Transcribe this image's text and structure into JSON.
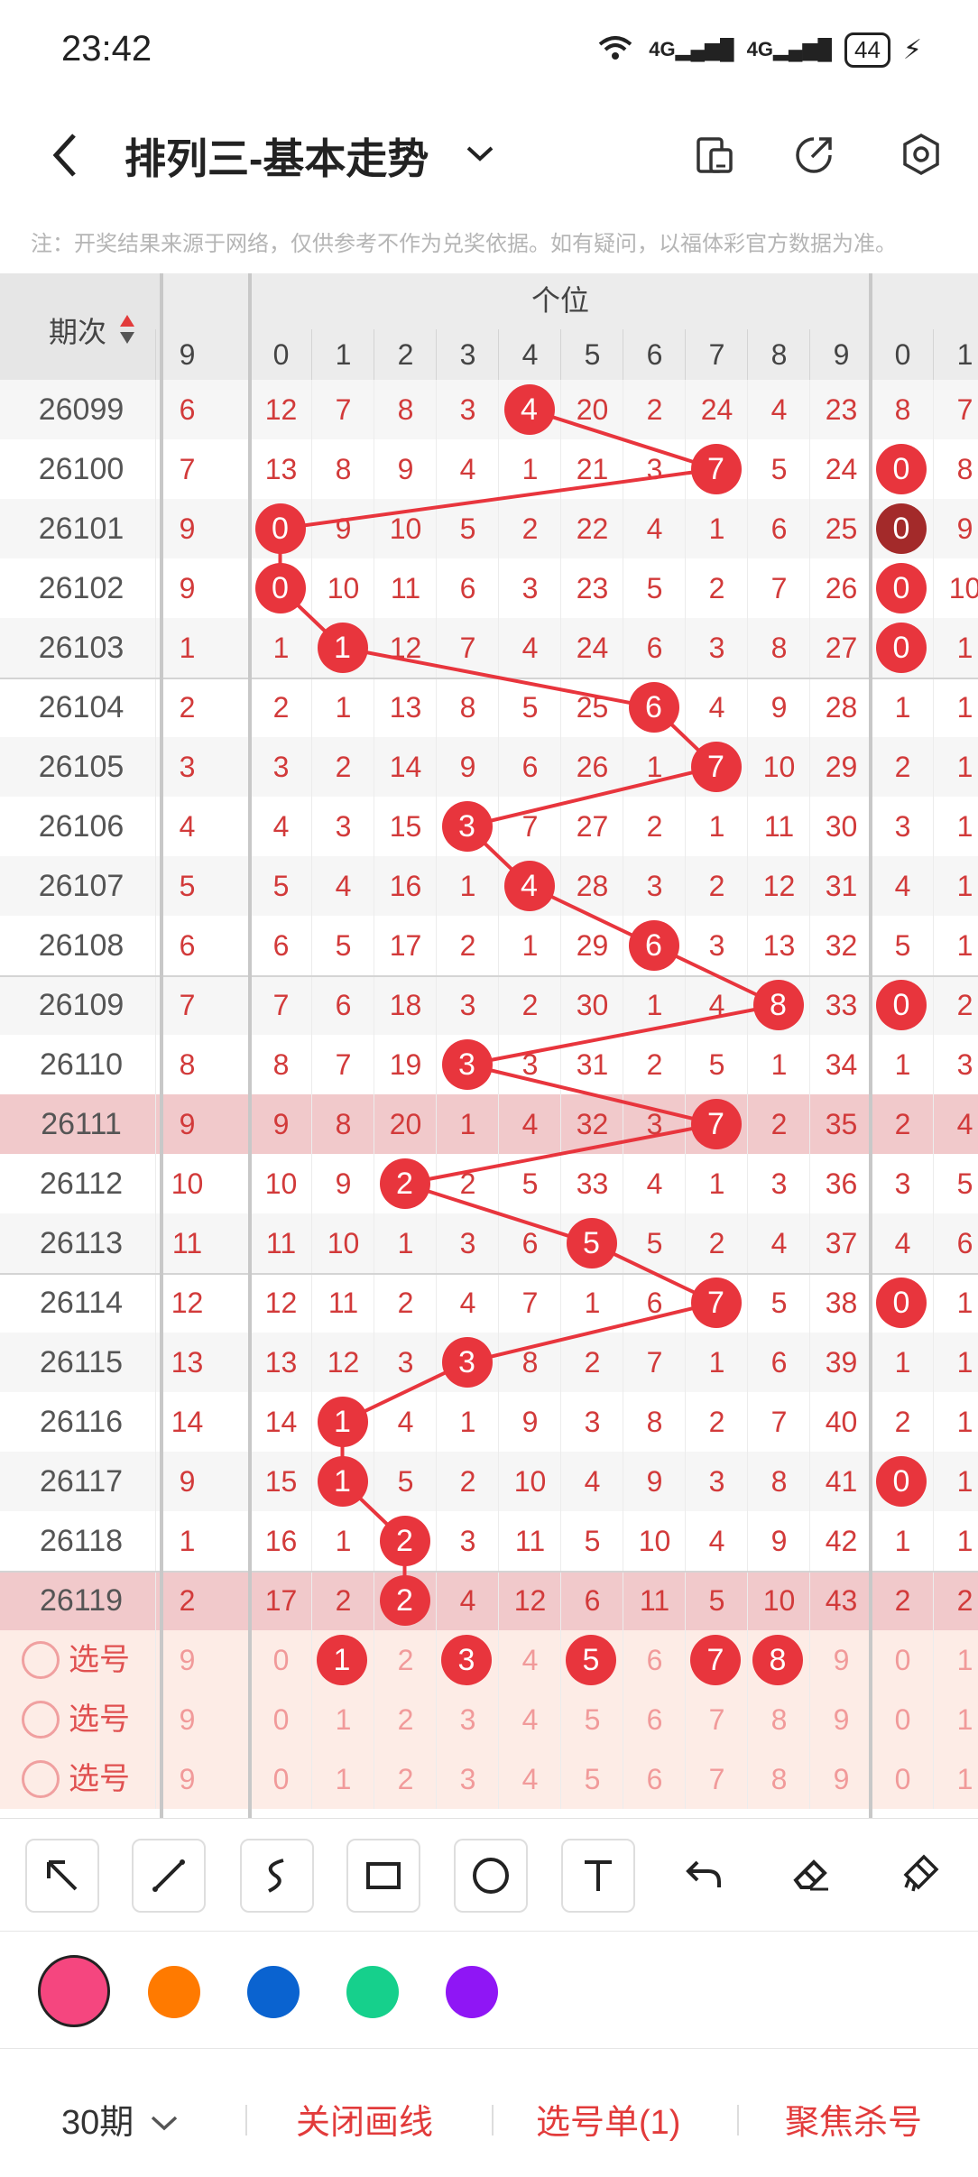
{
  "status": {
    "time": "23:42",
    "battery": "44",
    "signal1": "4G",
    "signal2": "4G",
    "wifi_badge": "6"
  },
  "header": {
    "title": "排列三-基本走势"
  },
  "notice": "注：开奖结果来源于网络，仅供参考不作为兑奖依据。如有疑问，以福体彩官方数据为准。",
  "table": {
    "term_header": "期次",
    "group_label": "个位",
    "left_partial_col": "9",
    "digit_cols": [
      "0",
      "1",
      "2",
      "3",
      "4",
      "5",
      "6",
      "7",
      "8",
      "9"
    ],
    "right_cols": [
      "0",
      "1"
    ],
    "rows": [
      {
        "term": "26099",
        "prev": "6",
        "cells": [
          "12",
          "7",
          "8",
          "3",
          "4",
          "20",
          "2",
          "24",
          "4",
          "23"
        ],
        "hit": 4,
        "r": [
          "8",
          "7"
        ]
      },
      {
        "term": "26100",
        "prev": "7",
        "cells": [
          "13",
          "8",
          "9",
          "4",
          "1",
          "21",
          "3",
          "7",
          "5",
          "24"
        ],
        "hit": 7,
        "r": [
          "0",
          "8"
        ]
      },
      {
        "term": "26101",
        "prev": "9",
        "cells": [
          "0",
          "9",
          "10",
          "5",
          "2",
          "22",
          "4",
          "1",
          "6",
          "25"
        ],
        "hit": 0,
        "r": [
          "0",
          "9"
        ]
      },
      {
        "term": "26102",
        "prev": "9",
        "cells": [
          "0",
          "10",
          "11",
          "6",
          "3",
          "23",
          "5",
          "2",
          "7",
          "26"
        ],
        "hit": 0,
        "r": [
          "0",
          "10"
        ]
      },
      {
        "term": "26103",
        "prev": "1",
        "cells": [
          "1",
          "1",
          "12",
          "7",
          "4",
          "24",
          "6",
          "3",
          "8",
          "27"
        ],
        "hit": 1,
        "r": [
          "0",
          "1"
        ]
      },
      {
        "term": "26104",
        "prev": "2",
        "cells": [
          "2",
          "1",
          "13",
          "8",
          "5",
          "25",
          "6",
          "4",
          "9",
          "28"
        ],
        "hit": 6,
        "r": [
          "1",
          "1"
        ]
      },
      {
        "term": "26105",
        "prev": "3",
        "cells": [
          "3",
          "2",
          "14",
          "9",
          "6",
          "26",
          "1",
          "7",
          "10",
          "29"
        ],
        "hit": 7,
        "r": [
          "2",
          "1"
        ]
      },
      {
        "term": "26106",
        "prev": "4",
        "cells": [
          "4",
          "3",
          "15",
          "3",
          "7",
          "27",
          "2",
          "1",
          "11",
          "30"
        ],
        "hit": 3,
        "r": [
          "3",
          "1"
        ]
      },
      {
        "term": "26107",
        "prev": "5",
        "cells": [
          "5",
          "4",
          "16",
          "1",
          "4",
          "28",
          "3",
          "2",
          "12",
          "31"
        ],
        "hit": 4,
        "r": [
          "4",
          "1"
        ]
      },
      {
        "term": "26108",
        "prev": "6",
        "cells": [
          "6",
          "5",
          "17",
          "2",
          "1",
          "29",
          "6",
          "3",
          "13",
          "32"
        ],
        "hit": 6,
        "r": [
          "5",
          "1"
        ]
      },
      {
        "term": "26109",
        "prev": "7",
        "cells": [
          "7",
          "6",
          "18",
          "3",
          "2",
          "30",
          "1",
          "4",
          "8",
          "33"
        ],
        "hit": 8,
        "r": [
          "0",
          "2"
        ]
      },
      {
        "term": "26110",
        "prev": "8",
        "cells": [
          "8",
          "7",
          "19",
          "3",
          "3",
          "31",
          "2",
          "5",
          "1",
          "34"
        ],
        "hit": 3,
        "r": [
          "1",
          "3"
        ]
      },
      {
        "term": "26111",
        "prev": "9",
        "cells": [
          "9",
          "8",
          "20",
          "1",
          "4",
          "32",
          "3",
          "7",
          "2",
          "35"
        ],
        "hit": 7,
        "r": [
          "2",
          "4"
        ]
      },
      {
        "term": "26112",
        "prev": "10",
        "cells": [
          "10",
          "9",
          "2",
          "2",
          "5",
          "33",
          "4",
          "1",
          "3",
          "36"
        ],
        "hit": 2,
        "r": [
          "3",
          "5"
        ]
      },
      {
        "term": "26113",
        "prev": "11",
        "cells": [
          "11",
          "10",
          "1",
          "3",
          "6",
          "5",
          "5",
          "2",
          "4",
          "37"
        ],
        "hit": 5,
        "r": [
          "4",
          "6"
        ]
      },
      {
        "term": "26114",
        "prev": "12",
        "cells": [
          "12",
          "11",
          "2",
          "4",
          "7",
          "1",
          "6",
          "7",
          "5",
          "38"
        ],
        "hit": 7,
        "r": [
          "0",
          "1"
        ]
      },
      {
        "term": "26115",
        "prev": "13",
        "cells": [
          "13",
          "12",
          "3",
          "3",
          "8",
          "2",
          "7",
          "1",
          "6",
          "39"
        ],
        "hit": 3,
        "r": [
          "1",
          "1"
        ]
      },
      {
        "term": "26116",
        "prev": "14",
        "cells": [
          "14",
          "1",
          "4",
          "1",
          "9",
          "3",
          "8",
          "2",
          "7",
          "40"
        ],
        "hit": 1,
        "r": [
          "2",
          "1"
        ]
      },
      {
        "term": "26117",
        "prev": "9",
        "cells": [
          "15",
          "1",
          "5",
          "2",
          "10",
          "4",
          "9",
          "3",
          "8",
          "41"
        ],
        "hit": 1,
        "r": [
          "0",
          "1"
        ]
      },
      {
        "term": "26118",
        "prev": "1",
        "cells": [
          "16",
          "1",
          "2",
          "3",
          "11",
          "5",
          "10",
          "4",
          "9",
          "42"
        ],
        "hit": 2,
        "r": [
          "1",
          "1"
        ]
      },
      {
        "term": "26119",
        "prev": "2",
        "cells": [
          "17",
          "2",
          "2",
          "4",
          "12",
          "6",
          "11",
          "5",
          "10",
          "43"
        ],
        "hit": 2,
        "r": [
          "2",
          "2"
        ]
      }
    ],
    "pick_rows": [
      {
        "label": "选号",
        "prev": "9",
        "cells": [
          "0",
          "1",
          "2",
          "3",
          "4",
          "5",
          "6",
          "7",
          "8",
          "9"
        ],
        "r": [
          "0",
          "1"
        ],
        "sel": [
          1,
          3,
          5,
          7,
          8
        ]
      },
      {
        "label": "选号",
        "prev": "9",
        "cells": [
          "0",
          "1",
          "2",
          "3",
          "4",
          "5",
          "6",
          "7",
          "8",
          "9"
        ],
        "r": [
          "0",
          "1"
        ],
        "sel": []
      },
      {
        "label": "选号",
        "prev": "9",
        "cells": [
          "0",
          "1",
          "2",
          "3",
          "4",
          "5",
          "6",
          "7",
          "8",
          "9"
        ],
        "r": [
          "0",
          "1"
        ],
        "sel": []
      }
    ]
  },
  "tools": [
    "arrow-tool",
    "line-tool",
    "curve-tool",
    "rectangle-tool",
    "circle-tool",
    "text-tool",
    "undo-tool",
    "eraser-tool",
    "clear-tool"
  ],
  "colors": [
    "#f5467f",
    "#ff7a00",
    "#0a63d0",
    "#16d08c",
    "#8f16f5"
  ],
  "bottom": {
    "periods": "30期",
    "close_draw": "关闭画线",
    "pick_list": "选号单(1)",
    "focus_kill": "聚焦杀号"
  }
}
